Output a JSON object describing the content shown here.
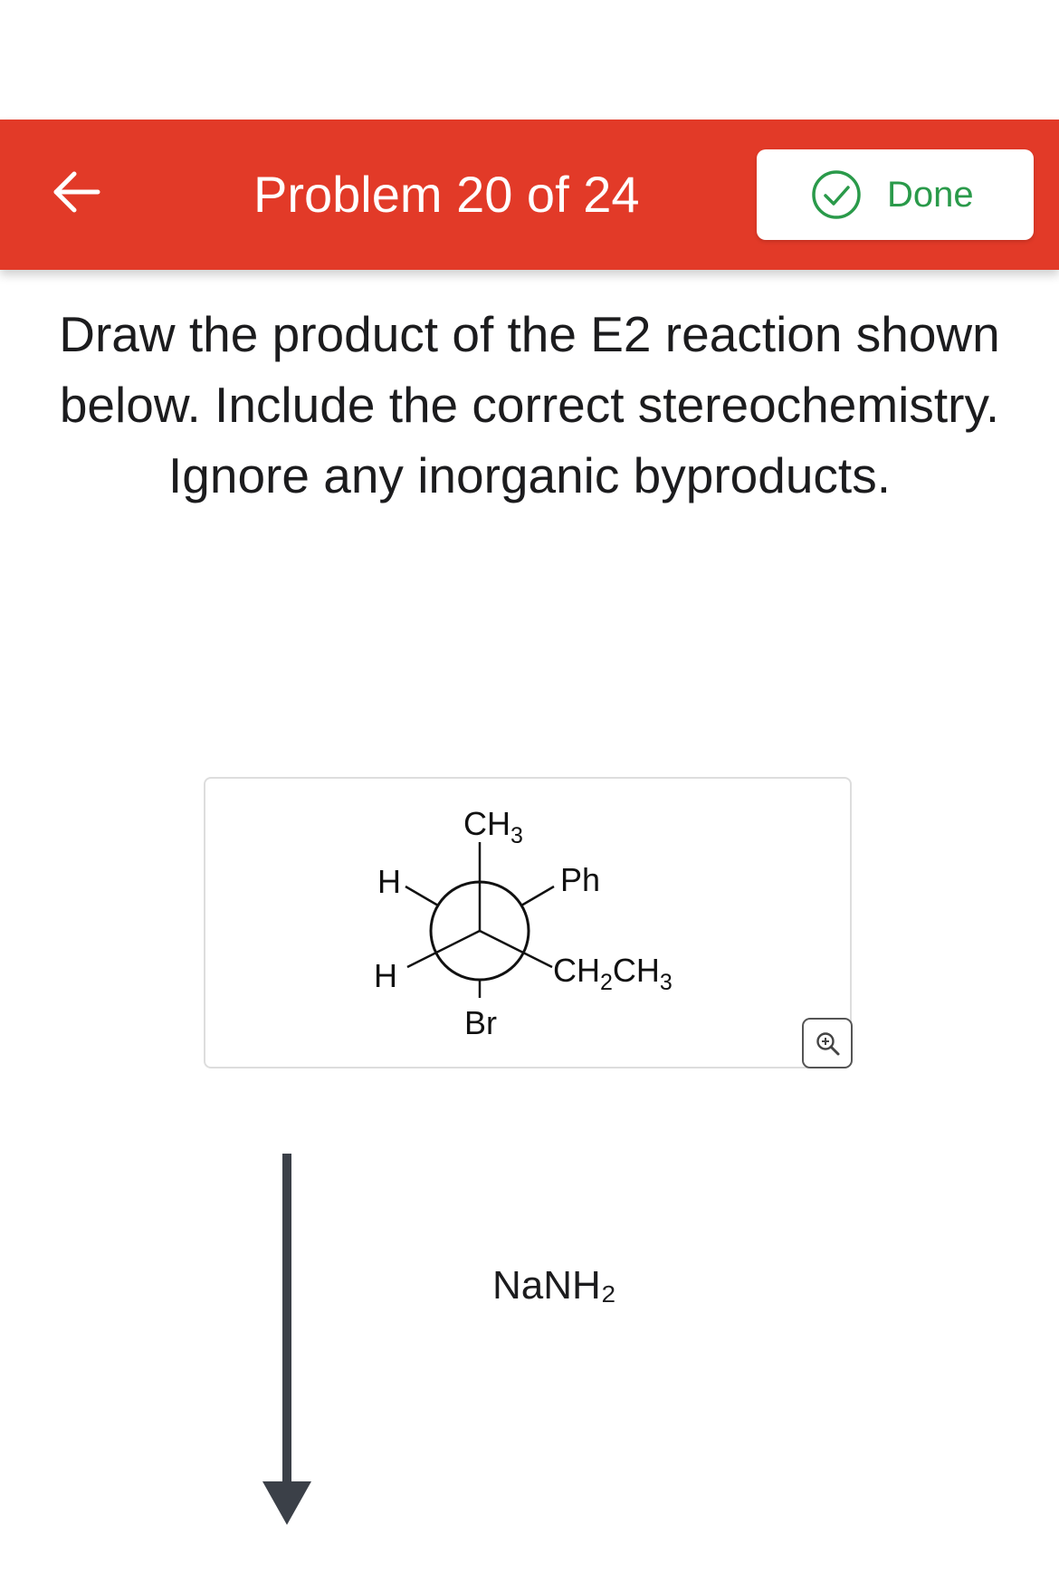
{
  "header": {
    "title": "Problem 20 of 24",
    "done_label": "Done",
    "background_color": "#e23a28",
    "done_color": "#2a9a4a"
  },
  "icons": {
    "back": "arrow-left-icon",
    "done": "check-circle-icon",
    "zoom": "zoom-in-icon"
  },
  "question": {
    "text": "Draw the product of the E2 reaction shown below. Include the correct stereochemistry. Ignore any inorganic byproducts."
  },
  "structure": {
    "type": "Newman projection",
    "front_top": "CH3",
    "front_right": "Ph",
    "front_left": "H",
    "back_right": "CH2CH3",
    "back_left": "H",
    "back_bottom": "Br"
  },
  "reaction": {
    "reagent": "NaNH₂"
  }
}
